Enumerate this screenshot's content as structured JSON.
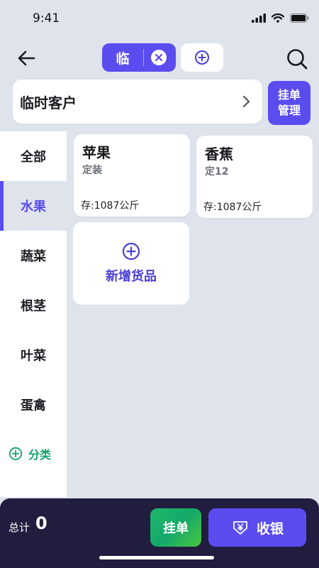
{
  "status_bar": {
    "time": "9:41"
  },
  "header": {
    "tab_label": "临",
    "icons": [
      "back-arrow-icon",
      "close-icon",
      "plus-circle-icon",
      "search-icon"
    ]
  },
  "customer": {
    "name": "临时客户"
  },
  "pending_button": {
    "line1": "挂单",
    "line2": "管理"
  },
  "sidebar": {
    "items": [
      {
        "label": "全部",
        "active": false
      },
      {
        "label": "水果",
        "active": true
      },
      {
        "label": "蔬菜",
        "active": false
      },
      {
        "label": "根茎",
        "active": false
      },
      {
        "label": "叶菜",
        "active": false
      },
      {
        "label": "蛋禽",
        "active": false
      }
    ],
    "add_category_label": "分类"
  },
  "products": [
    {
      "name": "苹果",
      "spec": "定装",
      "stock": "存:1087公斤"
    },
    {
      "name": "香蕉",
      "spec": "定12",
      "stock": "存:1087公斤"
    }
  ],
  "add_product": {
    "label": "新增货品"
  },
  "bottom_bar": {
    "total_label": "总计",
    "total_value": "0",
    "hang_label": "挂单",
    "checkout_label": "收银"
  },
  "colors": {
    "accent": "#5b4cf0",
    "background": "#dfe3ec",
    "bottom_bar": "#211d3f",
    "green": "#17a26a"
  }
}
